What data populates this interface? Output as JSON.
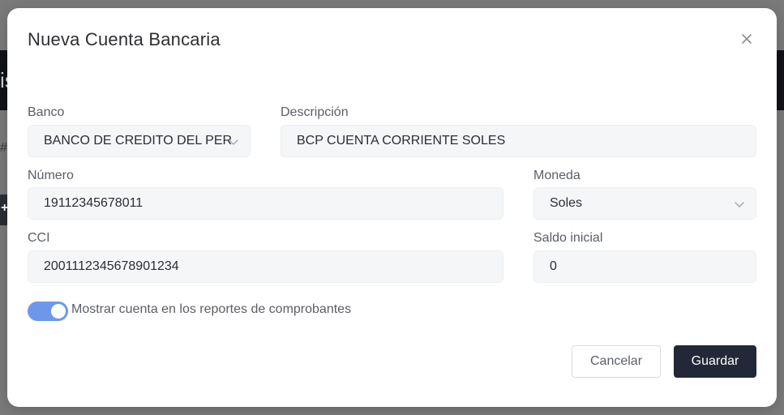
{
  "background": {
    "glyph": "is",
    "hash": "#",
    "button_icon": "+"
  },
  "modal": {
    "title": "Nueva Cuenta Bancaria",
    "close_icon": "close-icon"
  },
  "form": {
    "banco": {
      "label": "Banco",
      "value": "BANCO DE CREDITO DEL PER"
    },
    "descripcion": {
      "label": "Descripción",
      "value": "BCP CUENTA CORRIENTE SOLES"
    },
    "numero": {
      "label": "Número",
      "value": "19112345678011"
    },
    "moneda": {
      "label": "Moneda",
      "value": "Soles"
    },
    "cci": {
      "label": "CCI",
      "value": "2001112345678901234"
    },
    "saldo": {
      "label": "Saldo inicial",
      "value": "0"
    },
    "mostrar": {
      "label": "Mostrar cuenta en los reportes de comprobantes",
      "checked": true
    }
  },
  "actions": {
    "cancel_label": "Cancelar",
    "save_label": "Guardar"
  },
  "colors": {
    "primary": "#232838",
    "toggle_on": "#6e97ec"
  }
}
